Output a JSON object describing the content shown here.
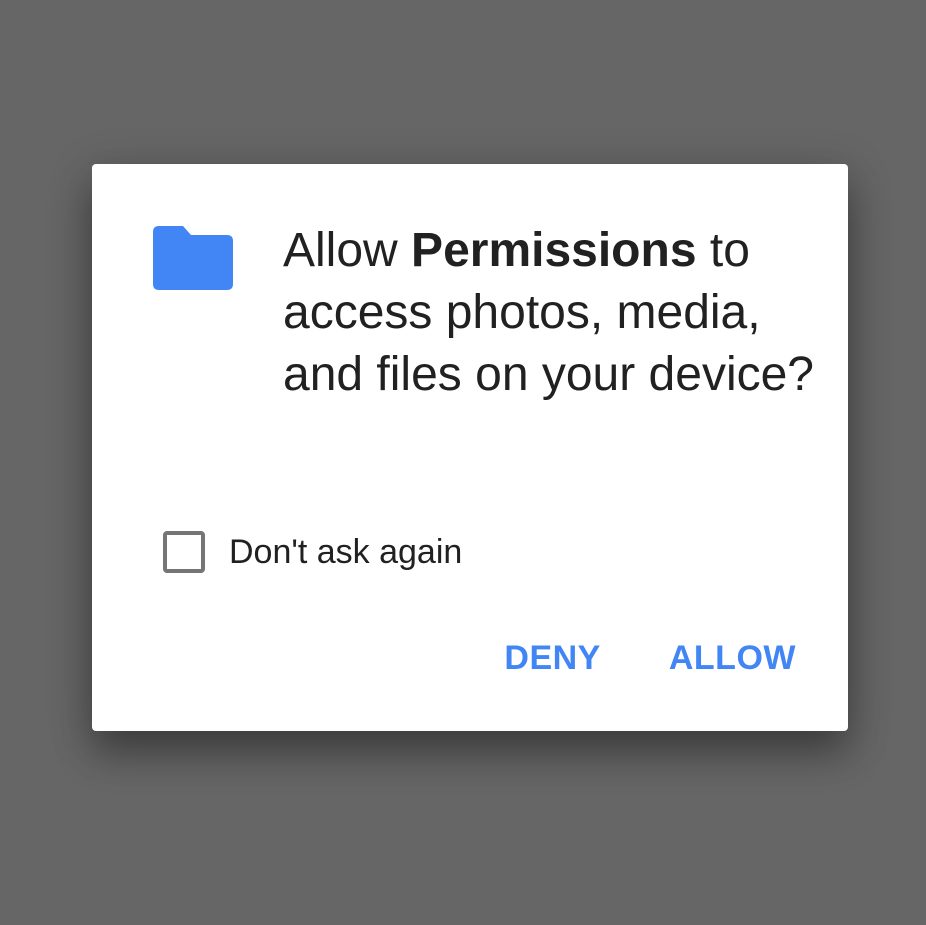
{
  "dialog": {
    "message_prefix": "Allow ",
    "app_name": "Permissions",
    "message_suffix": " to access photos, media, and files on your device?",
    "icon": "folder-icon",
    "checkbox_label": "Don't ask again",
    "checkbox_checked": false,
    "deny_label": "DENY",
    "allow_label": "ALLOW"
  },
  "colors": {
    "scrim": "#666666",
    "surface": "#ffffff",
    "accent": "#4285f4",
    "text": "#212121",
    "checkbox_border": "#757575"
  }
}
